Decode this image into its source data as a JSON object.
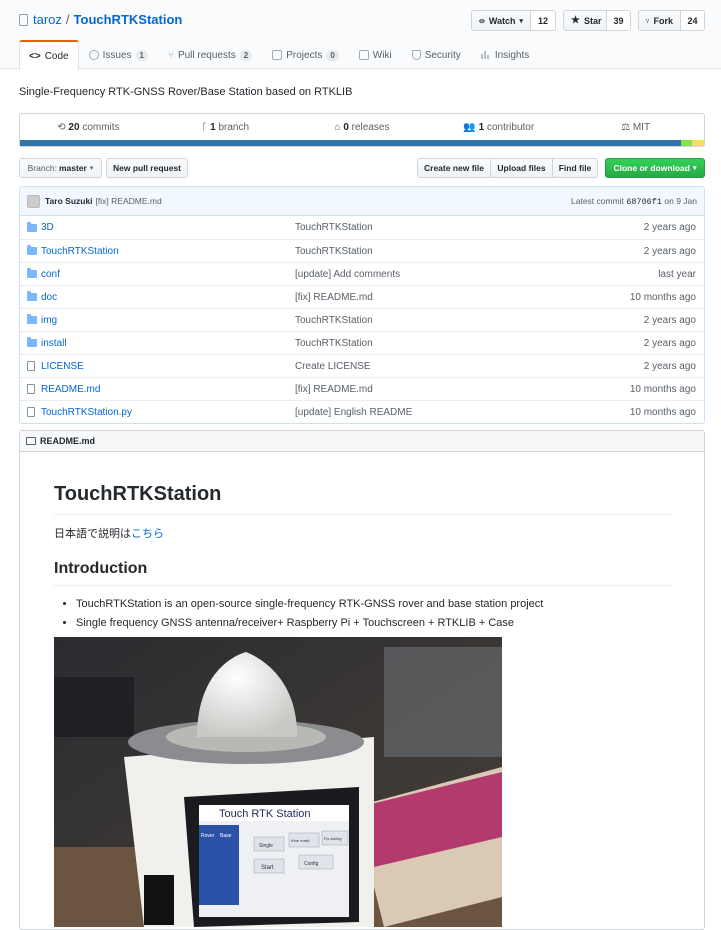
{
  "repo": {
    "owner": "taroz",
    "separator": "/",
    "name": "TouchRTKStation"
  },
  "social": {
    "watch_label": "Watch",
    "watch_count": "12",
    "star_label": "Star",
    "star_count": "39",
    "fork_label": "Fork",
    "fork_count": "24"
  },
  "tabs": [
    {
      "label": "Code"
    },
    {
      "label": "Issues",
      "count": "1"
    },
    {
      "label": "Pull requests",
      "count": "2"
    },
    {
      "label": "Projects",
      "count": "0"
    },
    {
      "label": "Wiki"
    },
    {
      "label": "Security"
    },
    {
      "label": "Insights"
    }
  ],
  "description": "Single-Frequency RTK-GNSS Rover/Base Station based on RTKLIB",
  "summary": {
    "commits_num": "20",
    "commits_label": " commits",
    "branch_num": "1",
    "branch_label": " branch",
    "releases_num": "0",
    "releases_label": " releases",
    "contrib_num": "1",
    "contrib_label": " contributor",
    "license": "MIT"
  },
  "language_bar": [
    {
      "color": "#3572A5",
      "fraction": 0.966
    },
    {
      "color": "#89e051",
      "fraction": 0.017
    },
    {
      "color": "#f1e05a",
      "fraction": 0.017
    }
  ],
  "filebar": {
    "branch_prefix": "Branch:",
    "branch_name": "master",
    "new_pr": "New pull request",
    "create_file": "Create new file",
    "upload_files": "Upload files",
    "find_file": "Find file",
    "clone": "Clone or download"
  },
  "commit": {
    "author": "Taro Suzuki",
    "message": "[fix] README.md",
    "latest_prefix": "Latest commit",
    "sha": "68706f1",
    "date_text": "on 9 Jan"
  },
  "files": [
    {
      "type": "dir",
      "name": "3D",
      "message": "TouchRTKStation",
      "age": "2 years ago"
    },
    {
      "type": "dir",
      "name": "TouchRTKStation",
      "message": "TouchRTKStation",
      "age": "2 years ago"
    },
    {
      "type": "dir",
      "name": "conf",
      "message": "[update] Add comments",
      "age": "last year"
    },
    {
      "type": "dir",
      "name": "doc",
      "message": "[fix] README.md",
      "age": "10 months ago"
    },
    {
      "type": "dir",
      "name": "img",
      "message": "TouchRTKStation",
      "age": "2 years ago"
    },
    {
      "type": "dir",
      "name": "install",
      "message": "TouchRTKStation",
      "age": "2 years ago"
    },
    {
      "type": "file",
      "name": "LICENSE",
      "message": "Create LICENSE",
      "age": "2 years ago"
    },
    {
      "type": "file",
      "name": "README.md",
      "message": "[fix] README.md",
      "age": "10 months ago"
    },
    {
      "type": "file",
      "name": "TouchRTKStation.py",
      "message": "[update] English README",
      "age": "10 months ago"
    }
  ],
  "readme": {
    "filename": "README.md",
    "h1": "TouchRTKStation",
    "jp_text": "日本語で説明は",
    "jp_link": "こちら",
    "h2": "Introduction",
    "bullets": [
      "TouchRTKStation is an open-source single-frequency RTK-GNSS rover and base station project",
      "Single frequency GNSS antenna/receiver+ Raspberry Pi + Touchscreen + RTKLIB + Case"
    ],
    "photo_screen_title": "Touch RTK Station",
    "photo_tabs": [
      "Rover",
      "Base"
    ],
    "photo_buttons": [
      "Single",
      "Kine matic",
      "Fix Ambig",
      "Start",
      "Config"
    ]
  }
}
